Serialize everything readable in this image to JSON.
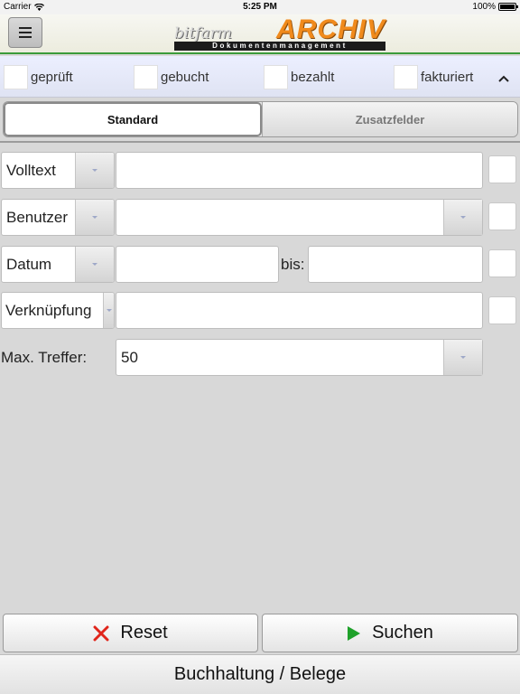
{
  "status": {
    "carrier": "Carrier",
    "time": "5:25 PM",
    "battery": "100%"
  },
  "header": {
    "brand": "bitfarm",
    "product": "ARCHIV",
    "subtitle": "Dokumentenmanagement"
  },
  "filters": [
    {
      "label": "geprüft",
      "checked": false
    },
    {
      "label": "gebucht",
      "checked": false
    },
    {
      "label": "bezahlt",
      "checked": false
    },
    {
      "label": "fakturiert",
      "checked": false
    }
  ],
  "tabs": [
    {
      "label": "Standard",
      "active": true
    },
    {
      "label": "Zusatzfelder",
      "active": false
    }
  ],
  "form": {
    "volltext": {
      "selector": "Volltext",
      "value": ""
    },
    "benutzer": {
      "selector": "Benutzer",
      "value": ""
    },
    "datum": {
      "selector": "Datum",
      "from": "",
      "to_label": "bis:",
      "to": ""
    },
    "verknuepfung": {
      "selector": "Verknüpfung",
      "value": ""
    },
    "max_treffer": {
      "label": "Max. Treffer:",
      "value": "50"
    }
  },
  "buttons": {
    "reset": "Reset",
    "search": "Suchen"
  },
  "footer": {
    "title": "Buchhaltung / Belege"
  },
  "colors": {
    "accent_green": "#3b9b3b",
    "logo_orange": "#f08a1c",
    "reset_red": "#e0251b",
    "search_green": "#1fa12a"
  },
  "icons": [
    "hamburger-icon",
    "wifi-icon",
    "battery-icon",
    "chevron-up-icon",
    "dropdown-arrow-icon",
    "close-x-icon",
    "play-icon"
  ]
}
